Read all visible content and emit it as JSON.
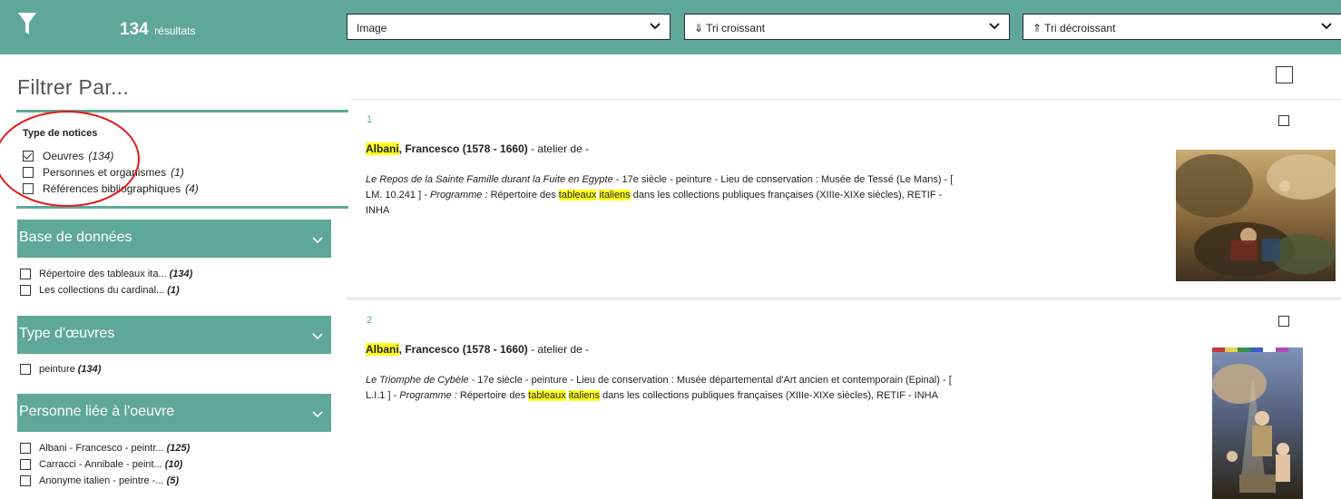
{
  "topbar": {
    "filter_icon": "funnel-icon",
    "results_count": "134",
    "results_label": "résultats",
    "select_type": "Image",
    "select_asc": "⇓ Tri croissant",
    "select_desc": "⇑ Tri décroissant",
    "chevron_icon": "chevron-down-icon"
  },
  "sidebar": {
    "heading": "Filtrer Par...",
    "type_notices": {
      "title": "Type de notices",
      "items": [
        {
          "label": "Oeuvres",
          "count": "(134)",
          "checked": true
        },
        {
          "label": "Personnes et organismes",
          "count": "(1)",
          "checked": false
        },
        {
          "label": "Références bibliographiques",
          "count": "(4)",
          "checked": false
        }
      ]
    },
    "facets": [
      {
        "title": "Base de données",
        "items": [
          {
            "label": "Répertoire des tableaux ita...",
            "count": "(134)"
          },
          {
            "label": "Les collections du cardinal...",
            "count": "(1)"
          }
        ]
      },
      {
        "title": "Type d'œuvres",
        "items": [
          {
            "label": "peinture",
            "count": "(134)"
          }
        ]
      },
      {
        "title": "Personne liée à l'oeuvre",
        "items": [
          {
            "label": "Albani - Francesco - peintr...",
            "count": "(125)"
          },
          {
            "label": "Carracci - Annibale - peint...",
            "count": "(10)"
          },
          {
            "label": "Anonyme italien - peintre -...",
            "count": "(5)"
          }
        ]
      }
    ]
  },
  "results": [
    {
      "index": "1",
      "artist": "Albani",
      "artist_rest": ", Francesco (1578 - 1660)",
      "role": " - atelier de -",
      "title": "Le Repos de la Sainte Famille durant la Fuite en Egypte",
      "details": " - 17e siècle - peinture - Lieu de conservation : Musée de Tessé (Le Mans) - [ LM. 10.241 ] - ",
      "programme_label": "Programme :",
      "programme_pre": " Répertoire des ",
      "hl1": "tableaux",
      "hl2": "italiens",
      "programme_post": " dans les collections publiques françaises (XIIIe-XIXe siècles), RETIF - INHA"
    },
    {
      "index": "2",
      "artist": "Albani",
      "artist_rest": ", Francesco (1578 - 1660)",
      "role": " - atelier de -",
      "title": "Le Triomphe de Cybèle",
      "details": " - 17e siècle - peinture - Lieu de conservation : Musée départemental d'Art ancien et contemporain (Epinal) - [ L.I.1 ] - ",
      "programme_label": "Programme :",
      "programme_pre": " Répertoire des ",
      "hl1": "tableaux",
      "hl2": "italiens",
      "programme_post": " dans les collections publiques françaises (XIIIe-XIXe siècles), RETIF - INHA"
    }
  ],
  "colors": {
    "accent": "#5fa898",
    "highlight": "#ffff1a",
    "annotation": "#e21b1b"
  }
}
